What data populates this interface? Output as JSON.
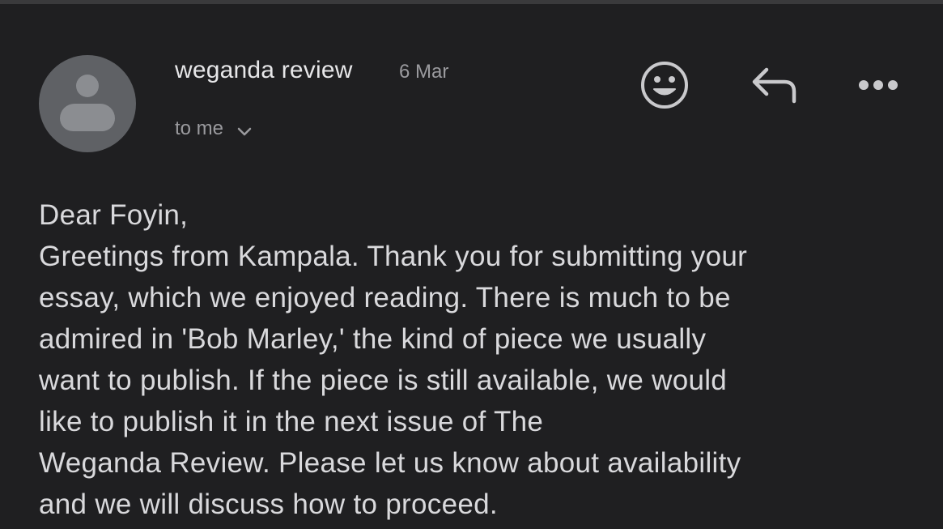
{
  "email": {
    "sender": "weganda review",
    "date": "6 Mar",
    "recipient": "to me",
    "body_lines": [
      "Dear Foyin,",
      "Greetings from Kampala. Thank you for submitting your",
      "essay, which we enjoyed reading. There is much to be",
      "admired in 'Bob Marley,' the kind of piece we usually",
      "want to publish. If the piece is still available, we would",
      "like to publish it in the next issue of The",
      "Weganda Review. Please let us know about availability",
      "and we will discuss how to proceed."
    ]
  },
  "icons": {
    "avatar": "person-icon",
    "recipient_toggle": "chevron-down-icon",
    "emoji": "smiley-face-icon",
    "reply": "reply-icon",
    "more": "more-horizontal-icon"
  },
  "colors": {
    "background": "#1f1f21",
    "primary_text": "#e6e6e8",
    "secondary_text": "#9a9a9e",
    "avatar_bg": "#5f6165"
  }
}
